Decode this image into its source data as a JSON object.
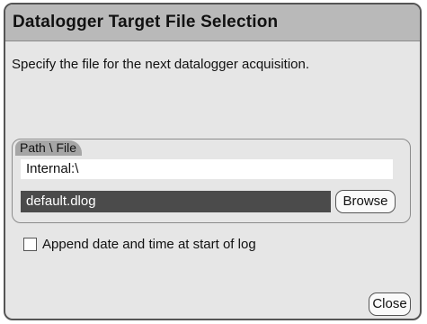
{
  "dialog": {
    "title": "Datalogger Target File Selection",
    "instruction": "Specify the file for the next datalogger acquisition.",
    "path_group": {
      "tab_label": "Path \\ File",
      "path_value": "Internal:\\",
      "file_value": "default.dlog",
      "browse_label": "Browse"
    },
    "append_option": {
      "label": "Append date and time at start of log",
      "checked": false
    },
    "close_label": "Close"
  },
  "colors": {
    "title_bar": "#b9b9b9",
    "dialog_bg": "#e6e6e6",
    "selected_field": "#4b4b4b",
    "group_tab": "#a6a6a6"
  }
}
